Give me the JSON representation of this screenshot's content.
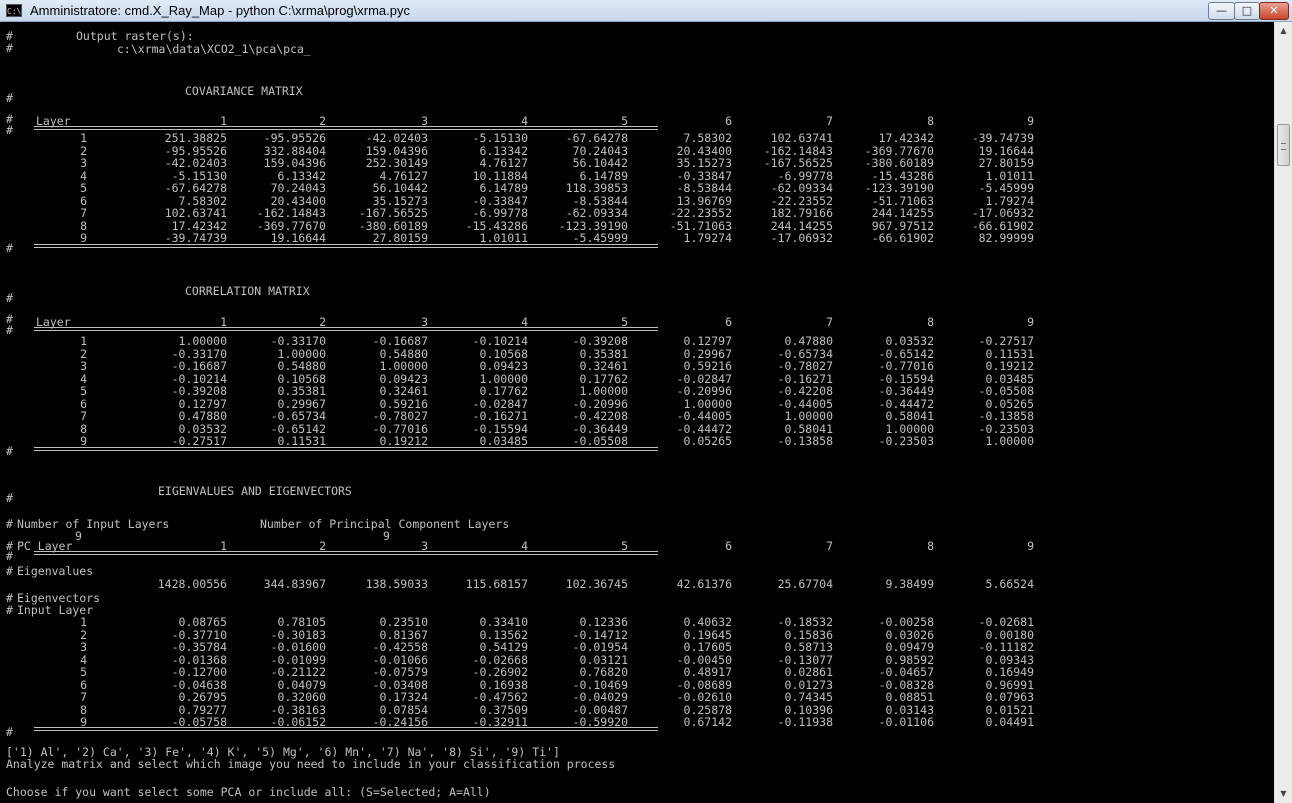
{
  "window": {
    "title": "Amministratore: cmd.X_Ray_Map - python  C:\\xrma\\prog\\xrma.pyc",
    "icon_label": "C:\\",
    "controls": {
      "minimize": "—",
      "maximize": "□",
      "close": "✕"
    }
  },
  "console": {
    "header": {
      "output_label": "Output raster(s):",
      "output_path": "c:\\xrma\\data\\XCO2_1\\pca\\pca_"
    },
    "covariance": {
      "title": "COVARIANCE MATRIX",
      "layer_label": "Layer",
      "columns": [
        "1",
        "2",
        "3",
        "4",
        "5",
        "6",
        "7",
        "8",
        "9"
      ],
      "rows": [
        [
          "1",
          "251.38825",
          "-95.95526",
          "-42.02403",
          "-5.15130",
          "-67.64278",
          "7.58302",
          "102.63741",
          "17.42342",
          "-39.74739"
        ],
        [
          "2",
          "-95.95526",
          "332.88404",
          "159.04396",
          "6.13342",
          "70.24043",
          "20.43400",
          "-162.14843",
          "-369.77670",
          "19.16644"
        ],
        [
          "3",
          "-42.02403",
          "159.04396",
          "252.30149",
          "4.76127",
          "56.10442",
          "35.15273",
          "-167.56525",
          "-380.60189",
          "27.80159"
        ],
        [
          "4",
          "-5.15130",
          "6.13342",
          "4.76127",
          "10.11884",
          "6.14789",
          "-0.33847",
          "-6.99778",
          "-15.43286",
          "1.01011"
        ],
        [
          "5",
          "-67.64278",
          "70.24043",
          "56.10442",
          "6.14789",
          "118.39853",
          "-8.53844",
          "-62.09334",
          "-123.39190",
          "-5.45999"
        ],
        [
          "6",
          "7.58302",
          "20.43400",
          "35.15273",
          "-0.33847",
          "-8.53844",
          "13.96769",
          "-22.23552",
          "-51.71063",
          "1.79274"
        ],
        [
          "7",
          "102.63741",
          "-162.14843",
          "-167.56525",
          "-6.99778",
          "-62.09334",
          "-22.23552",
          "182.79166",
          "244.14255",
          "-17.06932"
        ],
        [
          "8",
          "17.42342",
          "-369.77670",
          "-380.60189",
          "-15.43286",
          "-123.39190",
          "-51.71063",
          "244.14255",
          "967.97512",
          "-66.61902"
        ],
        [
          "9",
          "-39.74739",
          "19.16644",
          "27.80159",
          "1.01011",
          "-5.45999",
          "1.79274",
          "-17.06932",
          "-66.61902",
          "82.99999"
        ]
      ]
    },
    "correlation": {
      "title": "CORRELATION MATRIX",
      "layer_label": "Layer",
      "columns": [
        "1",
        "2",
        "3",
        "4",
        "5",
        "6",
        "7",
        "8",
        "9"
      ],
      "rows": [
        [
          "1",
          "1.00000",
          "-0.33170",
          "-0.16687",
          "-0.10214",
          "-0.39208",
          "0.12797",
          "0.47880",
          "0.03532",
          "-0.27517"
        ],
        [
          "2",
          "-0.33170",
          "1.00000",
          "0.54880",
          "0.10568",
          "0.35381",
          "0.29967",
          "-0.65734",
          "-0.65142",
          "0.11531"
        ],
        [
          "3",
          "-0.16687",
          "0.54880",
          "1.00000",
          "0.09423",
          "0.32461",
          "0.59216",
          "-0.78027",
          "-0.77016",
          "0.19212"
        ],
        [
          "4",
          "-0.10214",
          "0.10568",
          "0.09423",
          "1.00000",
          "0.17762",
          "-0.02847",
          "-0.16271",
          "-0.15594",
          "0.03485"
        ],
        [
          "5",
          "-0.39208",
          "0.35381",
          "0.32461",
          "0.17762",
          "1.00000",
          "-0.20996",
          "-0.42208",
          "-0.36449",
          "-0.05508"
        ],
        [
          "6",
          "0.12797",
          "0.29967",
          "0.59216",
          "-0.02847",
          "-0.20996",
          "1.00000",
          "-0.44005",
          "-0.44472",
          "0.05265"
        ],
        [
          "7",
          "0.47880",
          "-0.65734",
          "-0.78027",
          "-0.16271",
          "-0.42208",
          "-0.44005",
          "1.00000",
          "0.58041",
          "-0.13858"
        ],
        [
          "8",
          "0.03532",
          "-0.65142",
          "-0.77016",
          "-0.15594",
          "-0.36449",
          "-0.44472",
          "0.58041",
          "1.00000",
          "-0.23503"
        ],
        [
          "9",
          "-0.27517",
          "0.11531",
          "0.19212",
          "0.03485",
          "-0.05508",
          "0.05265",
          "-0.13858",
          "-0.23503",
          "1.00000"
        ]
      ]
    },
    "eigen": {
      "title": "EIGENVALUES AND EIGENVECTORS",
      "input_layers_label": "Number of Input Layers",
      "pc_layers_label": "Number of Principal Component Layers",
      "input_layers_value": "9",
      "pc_layers_value": "9",
      "pc_layer_label": "PC Layer",
      "columns": [
        "1",
        "2",
        "3",
        "4",
        "5",
        "6",
        "7",
        "8",
        "9"
      ],
      "eigenvalues_label": "Eigenvalues",
      "eigenvalues": [
        "1428.00556",
        "344.83967",
        "138.59033",
        "115.68157",
        "102.36745",
        "42.61376",
        "25.67704",
        "9.38499",
        "5.66524"
      ],
      "eigenvectors_label": "Eigenvectors",
      "input_layer_label": "Input Layer",
      "vectors": [
        [
          "1",
          "0.08765",
          "0.78105",
          "0.23510",
          "0.33410",
          "0.12336",
          "0.40632",
          "-0.18532",
          "-0.00258",
          "-0.02681"
        ],
        [
          "2",
          "-0.37710",
          "-0.30183",
          "0.81367",
          "0.13562",
          "-0.14712",
          "0.19645",
          "0.15836",
          "0.03026",
          "0.00180"
        ],
        [
          "3",
          "-0.35784",
          "-0.01600",
          "-0.42558",
          "0.54129",
          "-0.01954",
          "0.17605",
          "0.58713",
          "0.09479",
          "-0.11182"
        ],
        [
          "4",
          "-0.01368",
          "-0.01099",
          "-0.01066",
          "-0.02668",
          "0.03121",
          "-0.00450",
          "-0.13077",
          "0.98592",
          "0.09343"
        ],
        [
          "5",
          "-0.12700",
          "-0.21122",
          "-0.07579",
          "-0.26902",
          "0.76820",
          "0.48917",
          "0.02861",
          "-0.04657",
          "0.16949"
        ],
        [
          "6",
          "-0.04638",
          "0.04079",
          "-0.03408",
          "0.16938",
          "-0.10469",
          "-0.08689",
          "0.01273",
          "-0.08328",
          "0.96991"
        ],
        [
          "7",
          "0.26795",
          "0.32060",
          "0.17324",
          "-0.47562",
          "-0.04029",
          "-0.02610",
          "0.74345",
          "0.08851",
          "0.07963"
        ],
        [
          "8",
          "0.79277",
          "-0.38163",
          "0.07854",
          "0.37509",
          "-0.00487",
          "0.25878",
          "0.10396",
          "0.03143",
          "0.01521"
        ],
        [
          "9",
          "-0.05758",
          "-0.06152",
          "-0.24156",
          "-0.32911",
          "-0.59920",
          "0.67142",
          "-0.11938",
          "-0.01106",
          "0.04491"
        ]
      ]
    },
    "footer": {
      "list_line": "['1) Al', '2) Ca', '3) Fe', '4) K', '5) Mg', '6) Mn', '7) Na', '8) Si', '9) Ti']",
      "analyze_line": "Analyze matrix and select which image you need to include in your classification process",
      "prompt_line": "Choose if you want select some PCA or include all: (S=Selected; A=All)"
    }
  },
  "scrollbar": {
    "up_arrow": "▲",
    "down_arrow": "▼"
  },
  "colors": {
    "console_bg": "#000000",
    "console_text": "#c0c0c0",
    "titlebar": "#dfeaf5",
    "close_button": "#c7452d"
  }
}
